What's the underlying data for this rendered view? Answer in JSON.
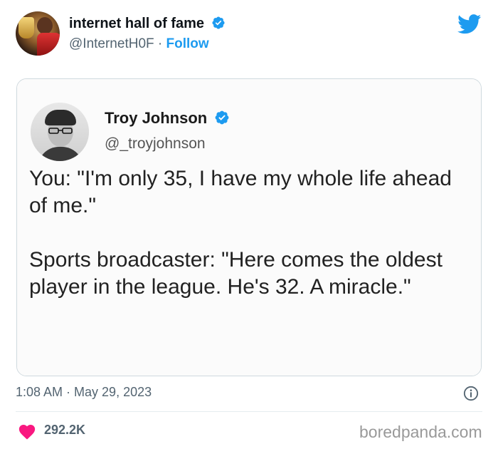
{
  "tweet": {
    "author_name": "internet hall of fame",
    "author_handle": "@InternetH0F",
    "separator": "·",
    "follow_label": "Follow",
    "timestamp": "1:08 AM · May 29, 2023",
    "likes": "292.2K"
  },
  "quoted": {
    "name": "Troy Johnson",
    "handle": "@_troyjohnson",
    "line1": "You: \"I'm only 35, I have my whole life ahead of me.\"",
    "line2": "Sports broadcaster: \"Here comes the oldest player in the league. He's 32. A miracle.\""
  },
  "watermark": "boredpanda.com",
  "colors": {
    "accent": "#1d9bf0",
    "like": "#f91880",
    "text": "#0f1419",
    "muted": "#536471"
  },
  "icons": {
    "verified": "verified-badge-icon",
    "brand": "twitter-bird-icon",
    "info": "info-icon",
    "like": "heart-icon"
  }
}
